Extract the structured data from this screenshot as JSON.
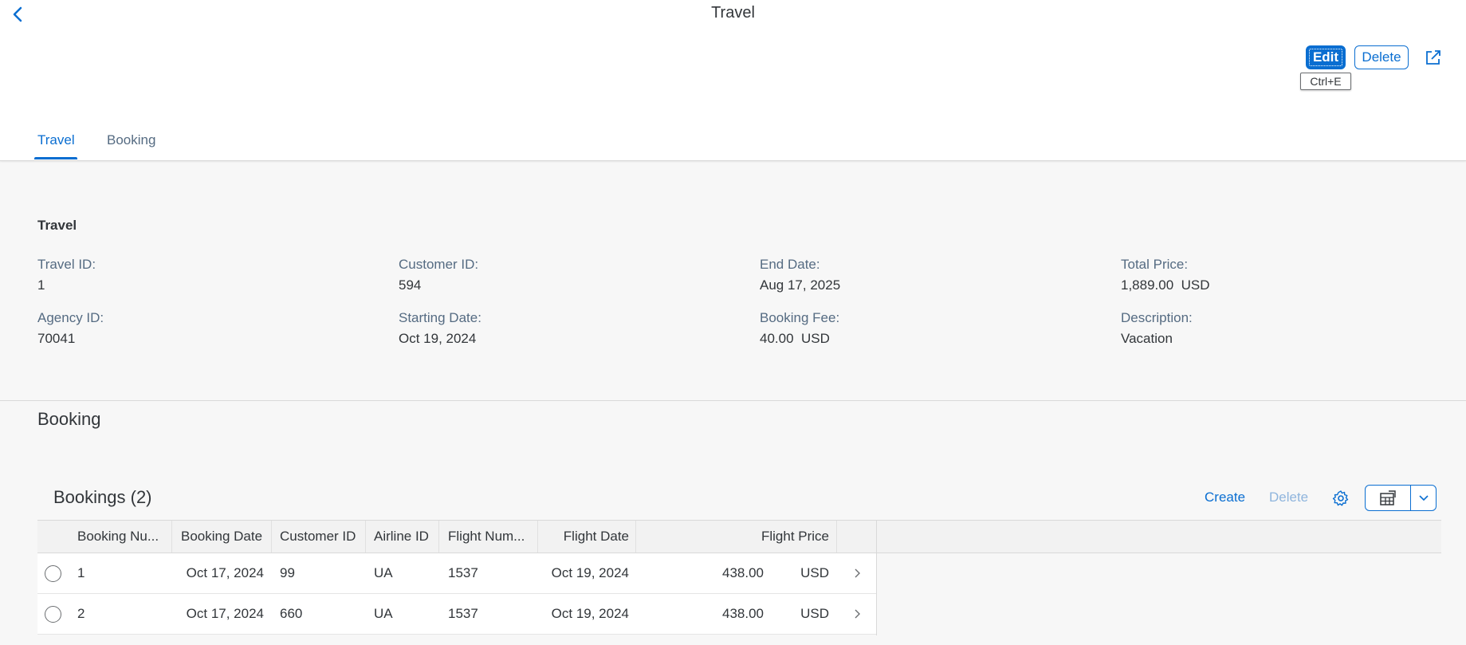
{
  "header": {
    "title": "Travel",
    "edit_label": "Edit",
    "delete_label": "Delete",
    "edit_tooltip": "Ctrl+E"
  },
  "tabs": [
    {
      "label": "Travel",
      "selected": true
    },
    {
      "label": "Booking",
      "selected": false
    }
  ],
  "travel": {
    "heading": "Travel",
    "fields": {
      "travel_id": {
        "label": "Travel ID:",
        "value": "1"
      },
      "agency_id": {
        "label": "Agency ID:",
        "value": "70041"
      },
      "customer_id": {
        "label": "Customer ID:",
        "value": "594"
      },
      "starting_date": {
        "label": "Starting Date:",
        "value": "Oct 19, 2024"
      },
      "end_date": {
        "label": "End Date:",
        "value": "Aug 17, 2025"
      },
      "booking_fee": {
        "label": "Booking Fee:",
        "value": "40.00  USD"
      },
      "total_price": {
        "label": "Total Price:",
        "value": "1,889.00  USD"
      },
      "description": {
        "label": "Description:",
        "value": "Vacation"
      }
    }
  },
  "booking_section": {
    "title": "Booking",
    "table_title": "Bookings (2)",
    "toolbar": {
      "create_label": "Create",
      "delete_label": "Delete"
    },
    "columns": [
      "Booking Nu...",
      "Booking Date",
      "Customer ID",
      "Airline ID",
      "Flight Num...",
      "Flight Date",
      "Flight Price"
    ],
    "rows": [
      {
        "booking_number": "1",
        "booking_date": "Oct 17, 2024",
        "customer_id": "99",
        "airline_id": "UA",
        "flight_number": "1537",
        "flight_date": "Oct 19, 2024",
        "flight_price": "438.00",
        "currency": "USD"
      },
      {
        "booking_number": "2",
        "booking_date": "Oct 17, 2024",
        "customer_id": "660",
        "airline_id": "UA",
        "flight_number": "1537",
        "flight_date": "Oct 19, 2024",
        "flight_price": "438.00",
        "currency": "USD"
      }
    ]
  },
  "icons": {
    "back": "chevron-left-icon",
    "share": "share-icon",
    "settings": "gear-icon",
    "export": "spreadsheet-export-icon",
    "dropdown": "chevron-down-icon",
    "row_nav": "chevron-right-icon"
  },
  "colors": {
    "accent": "#0a6ed1",
    "disabled": "#8fb5dd",
    "background": "#f7f7f7",
    "text": "#32363a",
    "label": "#556b82"
  }
}
